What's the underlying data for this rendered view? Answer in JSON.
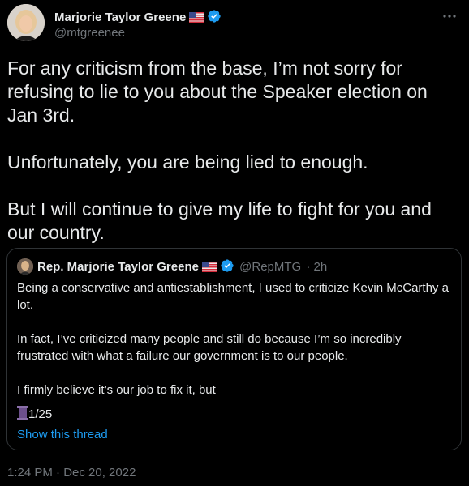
{
  "author": {
    "name": "Marjorie Taylor Greene",
    "handle": "@mtgreenee",
    "flag": "us-flag-icon",
    "verified": true
  },
  "tweet": {
    "paragraphs": [
      "For any criticism from the base, I’m not sorry for refusing to lie to you about the Speaker election on Jan 3rd.",
      "Unfortunately, you are being lied to enough.",
      "But I will continue to give my life to fight for you and our country."
    ],
    "timestamp": "1:24 PM · Dec 20, 2022"
  },
  "quoted": {
    "name": "Rep. Marjorie Taylor Greene",
    "handle": "@RepMTG",
    "time": "· 2h",
    "paragraphs": [
      "Being a conservative and antiestablishment, I used to criticize Kevin McCarthy a lot.",
      "In fact, I’ve criticized many people and still do because I’m so incredibly frustrated with what a failure our government is to our people.",
      "I firmly believe it’s our job to fix it, but"
    ],
    "counter": "1/25",
    "thread_link": "Show this thread"
  },
  "colors": {
    "background": "#000000",
    "text": "#e7e9ea",
    "secondary": "#71767b",
    "link": "#1d9bf0",
    "border": "#2f3336"
  }
}
